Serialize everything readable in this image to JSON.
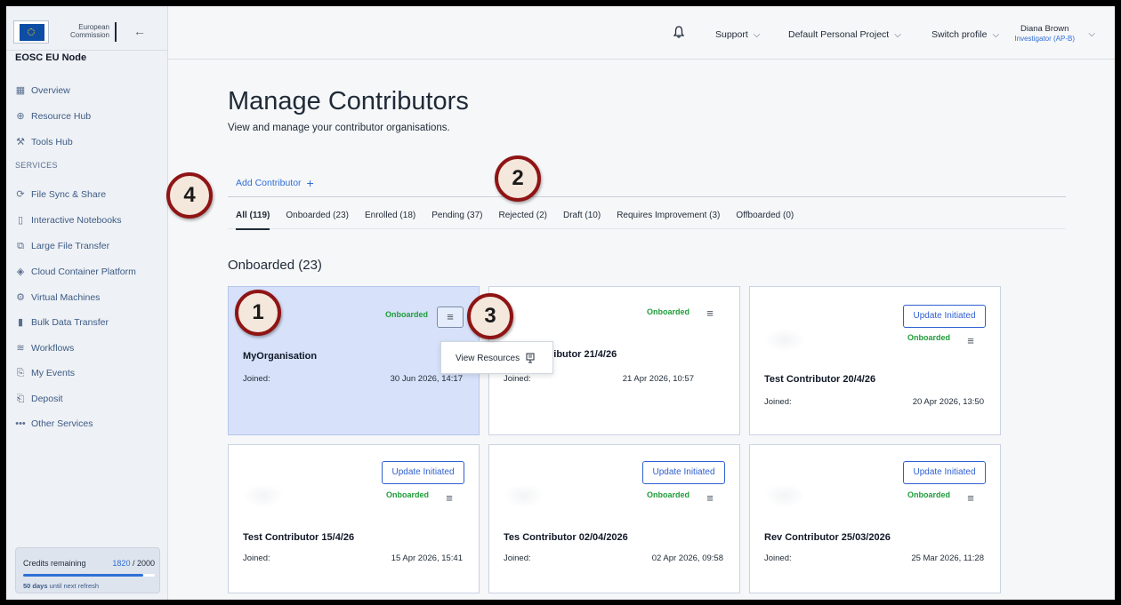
{
  "brand": {
    "org_line1": "European",
    "org_line2": "Commission",
    "node_title": "EOSC EU Node",
    "collapse_icon": "arrow-left-icon"
  },
  "sidebar": {
    "items_top": [
      {
        "label": "Overview",
        "icon": "grid-icon"
      },
      {
        "label": "Resource Hub",
        "icon": "globe-icon"
      },
      {
        "label": "Tools Hub",
        "icon": "tools-icon"
      }
    ],
    "services_label": "SERVICES",
    "services": [
      {
        "label": "File Sync & Share",
        "icon": "sync-icon"
      },
      {
        "label": "Interactive Notebooks",
        "icon": "notebook-icon"
      },
      {
        "label": "Large File Transfer",
        "icon": "transfer-icon"
      },
      {
        "label": "Cloud Container Platform",
        "icon": "container-icon"
      },
      {
        "label": "Virtual Machines",
        "icon": "vm-icon"
      },
      {
        "label": "Bulk Data Transfer",
        "icon": "bulk-icon"
      },
      {
        "label": "Workflows",
        "icon": "workflow-icon"
      },
      {
        "label": "My Events",
        "icon": "events-icon"
      },
      {
        "label": "Deposit",
        "icon": "deposit-icon"
      },
      {
        "label": "Other Services",
        "icon": "more-icon"
      }
    ],
    "credits": {
      "label": "Credits remaining",
      "value": "1820",
      "total": "/ 2000",
      "fraction": 0.91,
      "note_bold": "50 days",
      "note_rest": "until next refresh"
    }
  },
  "topbar": {
    "bell_icon": "bell-icon",
    "support": "Support",
    "project": "Default Personal Project",
    "switch_profile": "Switch profile",
    "user_name": "Diana Brown",
    "user_role": "Investigator (AP-B)"
  },
  "main": {
    "title": "Manage Contributors",
    "subtitle": "View and manage your contributor organisations.",
    "add_contributor": "Add Contributor",
    "tabs": [
      {
        "label": "All (119)",
        "active": true
      },
      {
        "label": "Onboarded (23)"
      },
      {
        "label": "Enrolled (18)"
      },
      {
        "label": "Pending (37)"
      },
      {
        "label": "Rejected (2)"
      },
      {
        "label": "Draft (10)"
      },
      {
        "label": "Requires Improvement (3)"
      },
      {
        "label": "Offboarded (0)"
      }
    ],
    "section_title": "Onboarded (23)",
    "joined_label": "Joined:",
    "cards": [
      {
        "name": "MyOrganisation",
        "status": "Onboarded",
        "joined": "30 Jun 2026, 14:17"
      },
      {
        "name": "ributor 21/4/26",
        "status": "Onboarded",
        "joined": "21 Apr 2026, 10:57"
      },
      {
        "name": "Test Contributor 20/4/26",
        "status": "Onboarded",
        "joined": "20 Apr 2026, 13:50",
        "update": "Update Initiated"
      },
      {
        "name": "Test Contributor 15/4/26",
        "status": "Onboarded",
        "joined": "15 Apr 2026, 15:41",
        "update": "Update Initiated"
      },
      {
        "name": "Tes Contributor 02/04/2026",
        "status": "Onboarded",
        "joined": "02 Apr 2026, 09:58",
        "update": "Update Initiated"
      },
      {
        "name": "Rev Contributor 25/03/2026",
        "status": "Onboarded",
        "joined": "25 Mar 2026, 11:28",
        "update": "Update Initiated"
      }
    ],
    "card2_partial_joined_label": "Joined:",
    "dropdown": {
      "label": "View Resources",
      "icon": "document-icon"
    }
  },
  "markers": [
    "1",
    "2",
    "3",
    "4"
  ],
  "colors": {
    "accent": "#2f6fd6",
    "status_green": "#1f9d3a",
    "marker_border": "#8f1414",
    "highlight_card": "#d7e2fa"
  }
}
